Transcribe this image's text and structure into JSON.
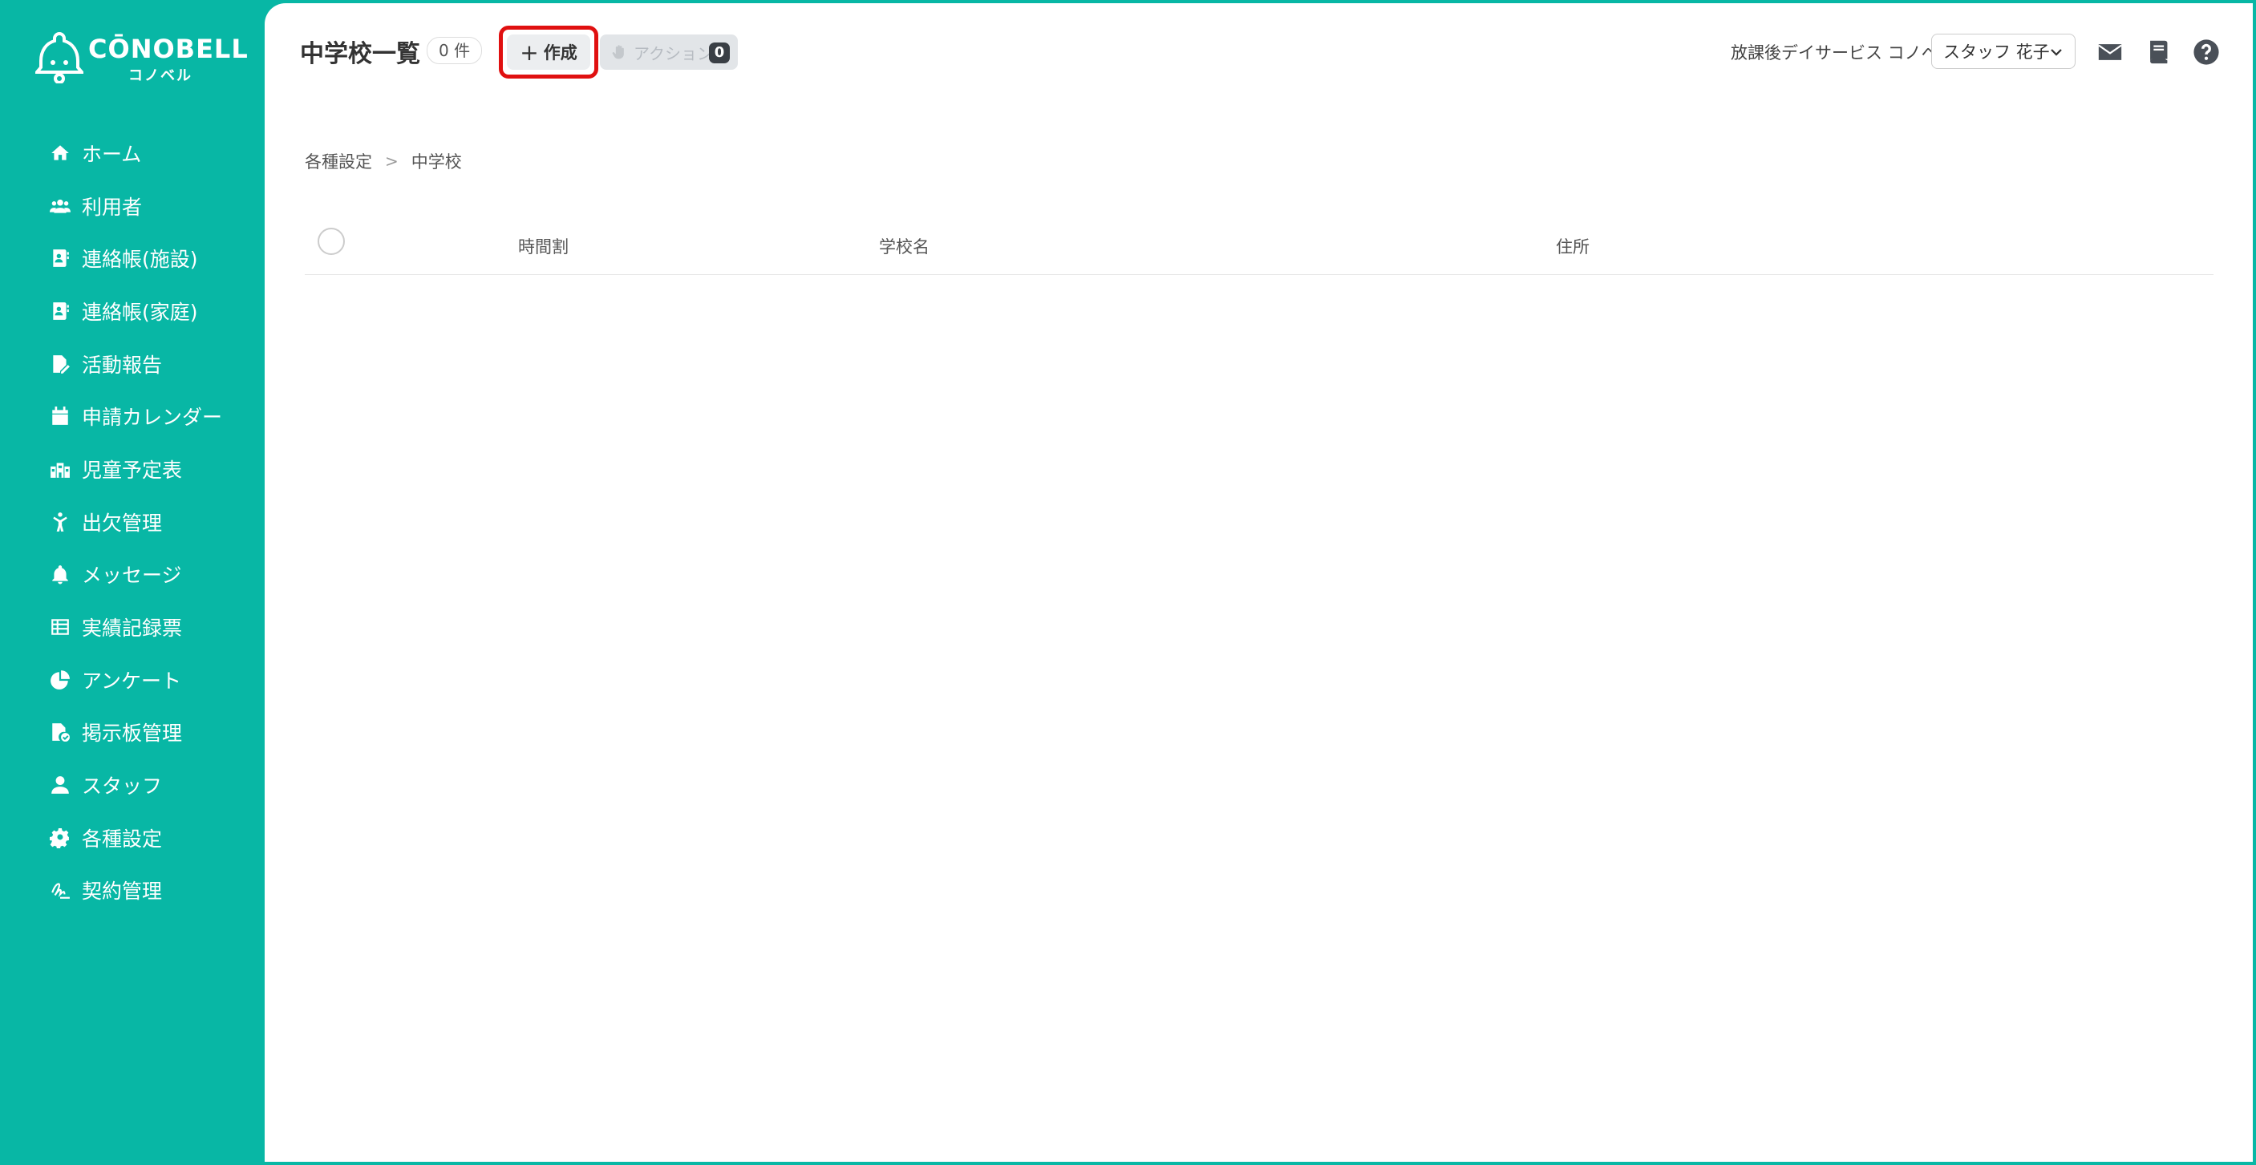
{
  "brand": {
    "name": "CŌNOBELL",
    "kana": "コノベル"
  },
  "sidebar": {
    "items": [
      {
        "label": "ホーム",
        "icon": "home-icon"
      },
      {
        "label": "利用者",
        "icon": "users-icon"
      },
      {
        "label": "連絡帳(施設)",
        "icon": "contact-book-icon"
      },
      {
        "label": "連絡帳(家庭)",
        "icon": "contact-book-icon"
      },
      {
        "label": "活動報告",
        "icon": "report-edit-icon"
      },
      {
        "label": "申請カレンダー",
        "icon": "calendar-icon"
      },
      {
        "label": "児童予定表",
        "icon": "school-icon"
      },
      {
        "label": "出欠管理",
        "icon": "person-icon"
      },
      {
        "label": "メッセージ",
        "icon": "bell-icon"
      },
      {
        "label": "実績記録票",
        "icon": "table-icon"
      },
      {
        "label": "アンケート",
        "icon": "pie-chart-icon"
      },
      {
        "label": "掲示板管理",
        "icon": "file-check-icon"
      },
      {
        "label": "スタッフ",
        "icon": "staff-icon"
      },
      {
        "label": "各種設定",
        "icon": "gear-icon"
      },
      {
        "label": "契約管理",
        "icon": "signature-icon"
      }
    ]
  },
  "header": {
    "title": "中学校一覧",
    "count": "0 件",
    "create_label": "作成",
    "action_label": "アクション",
    "action_count": "0",
    "facility": "放課後デイサービス コノベル",
    "staff": "スタッフ 花子"
  },
  "breadcrumb": [
    "各種設定",
    "中学校"
  ],
  "table": {
    "columns": [
      "時間割",
      "学校名",
      "住所"
    ],
    "rows": []
  },
  "colors": {
    "sidebar": "#08b7a5",
    "highlight": "#e01010"
  }
}
